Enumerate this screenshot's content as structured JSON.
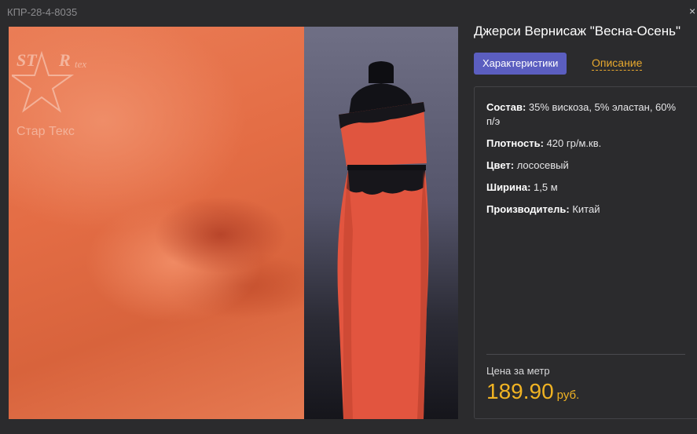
{
  "header": {
    "sku": "КПР-28-4-8035",
    "close_symbol": "×"
  },
  "logo": {
    "brand_latin": "STARtex",
    "brand_cyrillic": "Стар Текс"
  },
  "product": {
    "title": "Джерси Вернисаж \"Весна-Осень\"",
    "tabs": {
      "active": "Характеристики",
      "inactive": "Описание"
    },
    "specs": [
      {
        "label": "Состав:",
        "value": " 35% вискоза, 5% эластан, 60% п/э"
      },
      {
        "label": "Плотность:",
        "value": " 420 гр/м.кв."
      },
      {
        "label": "Цвет:",
        "value": " лососевый"
      },
      {
        "label": "Ширина:",
        "value": " 1,5 м"
      },
      {
        "label": "Производитель:",
        "value": " Китай"
      }
    ],
    "price": {
      "label": "Цена за метр",
      "amount": "189.90",
      "currency": "руб."
    }
  },
  "colors": {
    "accent_tab": "#5b5ec0",
    "link": "#e8a92e",
    "price": "#f0b323",
    "background": "#2b2b2d",
    "fabric": "#e46d45"
  }
}
